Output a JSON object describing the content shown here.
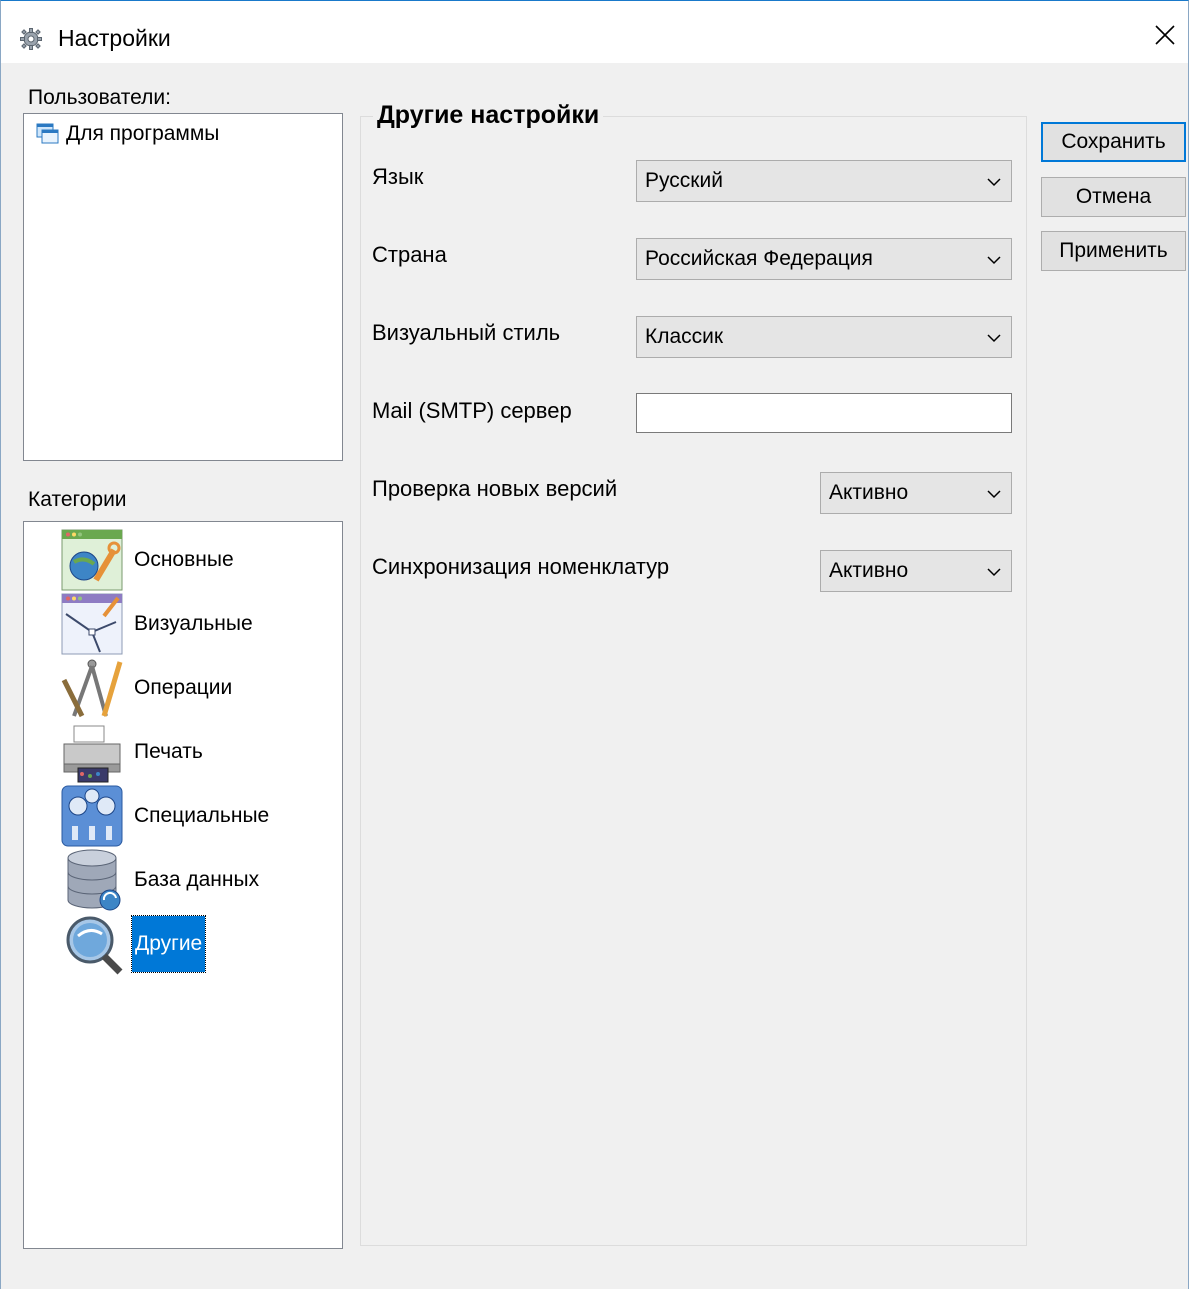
{
  "window": {
    "title": "Настройки"
  },
  "users": {
    "label": "Пользователи:",
    "items": [
      {
        "label": "Для программы"
      }
    ]
  },
  "categories": {
    "label": "Категории",
    "items": [
      {
        "label": "Основные",
        "icon": "general-settings-icon",
        "selected": false
      },
      {
        "label": "Визуальные",
        "icon": "visual-settings-icon",
        "selected": false
      },
      {
        "label": "Операции",
        "icon": "drafting-tools-icon",
        "selected": false
      },
      {
        "label": "Печать",
        "icon": "printer-icon",
        "selected": false
      },
      {
        "label": "Специальные",
        "icon": "gauges-icon",
        "selected": false
      },
      {
        "label": "База данных",
        "icon": "database-icon",
        "selected": false
      },
      {
        "label": "Другие",
        "icon": "magnifier-icon",
        "selected": true
      }
    ]
  },
  "other_settings": {
    "title": "Другие настройки",
    "language": {
      "label": "Язык",
      "value": "Русский"
    },
    "country": {
      "label": "Страна",
      "value": "Российская Федерация"
    },
    "visual_style": {
      "label": "Визуальный стиль",
      "value": "Классик"
    },
    "smtp": {
      "label": "Mail (SMTP) сервер",
      "value": ""
    },
    "check_versions": {
      "label": "Проверка новых версий",
      "value": "Активно"
    },
    "sync_nomenclature": {
      "label": "Синхронизация номенклатур",
      "value": "Активно"
    }
  },
  "buttons": {
    "save": "Сохранить",
    "cancel": "Отмена",
    "apply": "Применить"
  },
  "colors": {
    "selection": "#0078d7",
    "window_bg": "#f0f0f0"
  }
}
